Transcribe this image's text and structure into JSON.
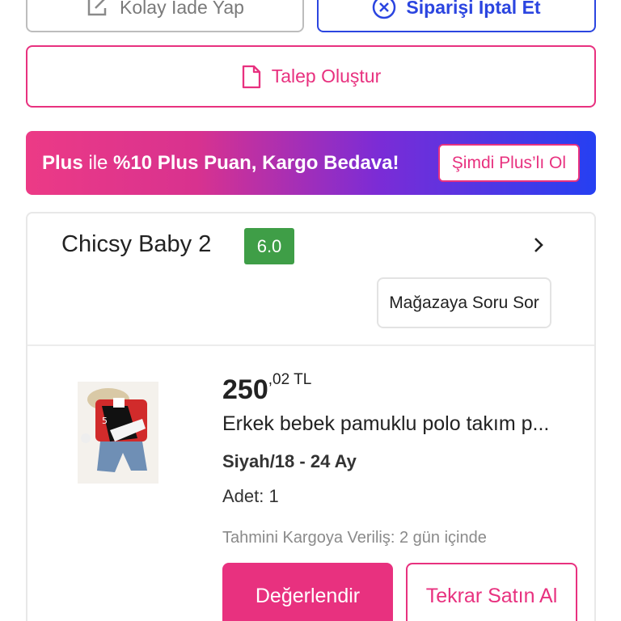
{
  "actions": {
    "easy_return_label": "Kolay İade Yap",
    "cancel_order_label": "Siparişi İptal Et",
    "create_request_label": "Talep Oluştur"
  },
  "plus_banner": {
    "brand": "Plus",
    "connector": "ile",
    "offer": "%10 Plus Puan, Kargo Bedava!",
    "cta_label": "Şimdi Plus’lı Ol"
  },
  "store": {
    "name": "Chicsy Baby 2",
    "rating": "6.0",
    "ask_label": "Mağazaya Soru Sor"
  },
  "product": {
    "price_main": "250",
    "price_fraction": ",02 TL",
    "name": "Erkek bebek pamuklu polo takım p...",
    "variant": "Siyah/18 - 24 Ay",
    "quantity": "Adet: 1",
    "shipping_eta": "Tahmini Kargoya Veriliş: 2 gün içinde"
  },
  "product_actions": {
    "rate_label": "Değerlendir",
    "rebuy_label": "Tekrar Satın Al"
  },
  "colors": {
    "brand_pink": "#e8317f",
    "brand_blue": "#2b45e0",
    "rating_green": "#3f9e47"
  },
  "icons": [
    "external-link-icon",
    "cancel-circle-icon",
    "document-icon",
    "chevron-right-icon"
  ]
}
